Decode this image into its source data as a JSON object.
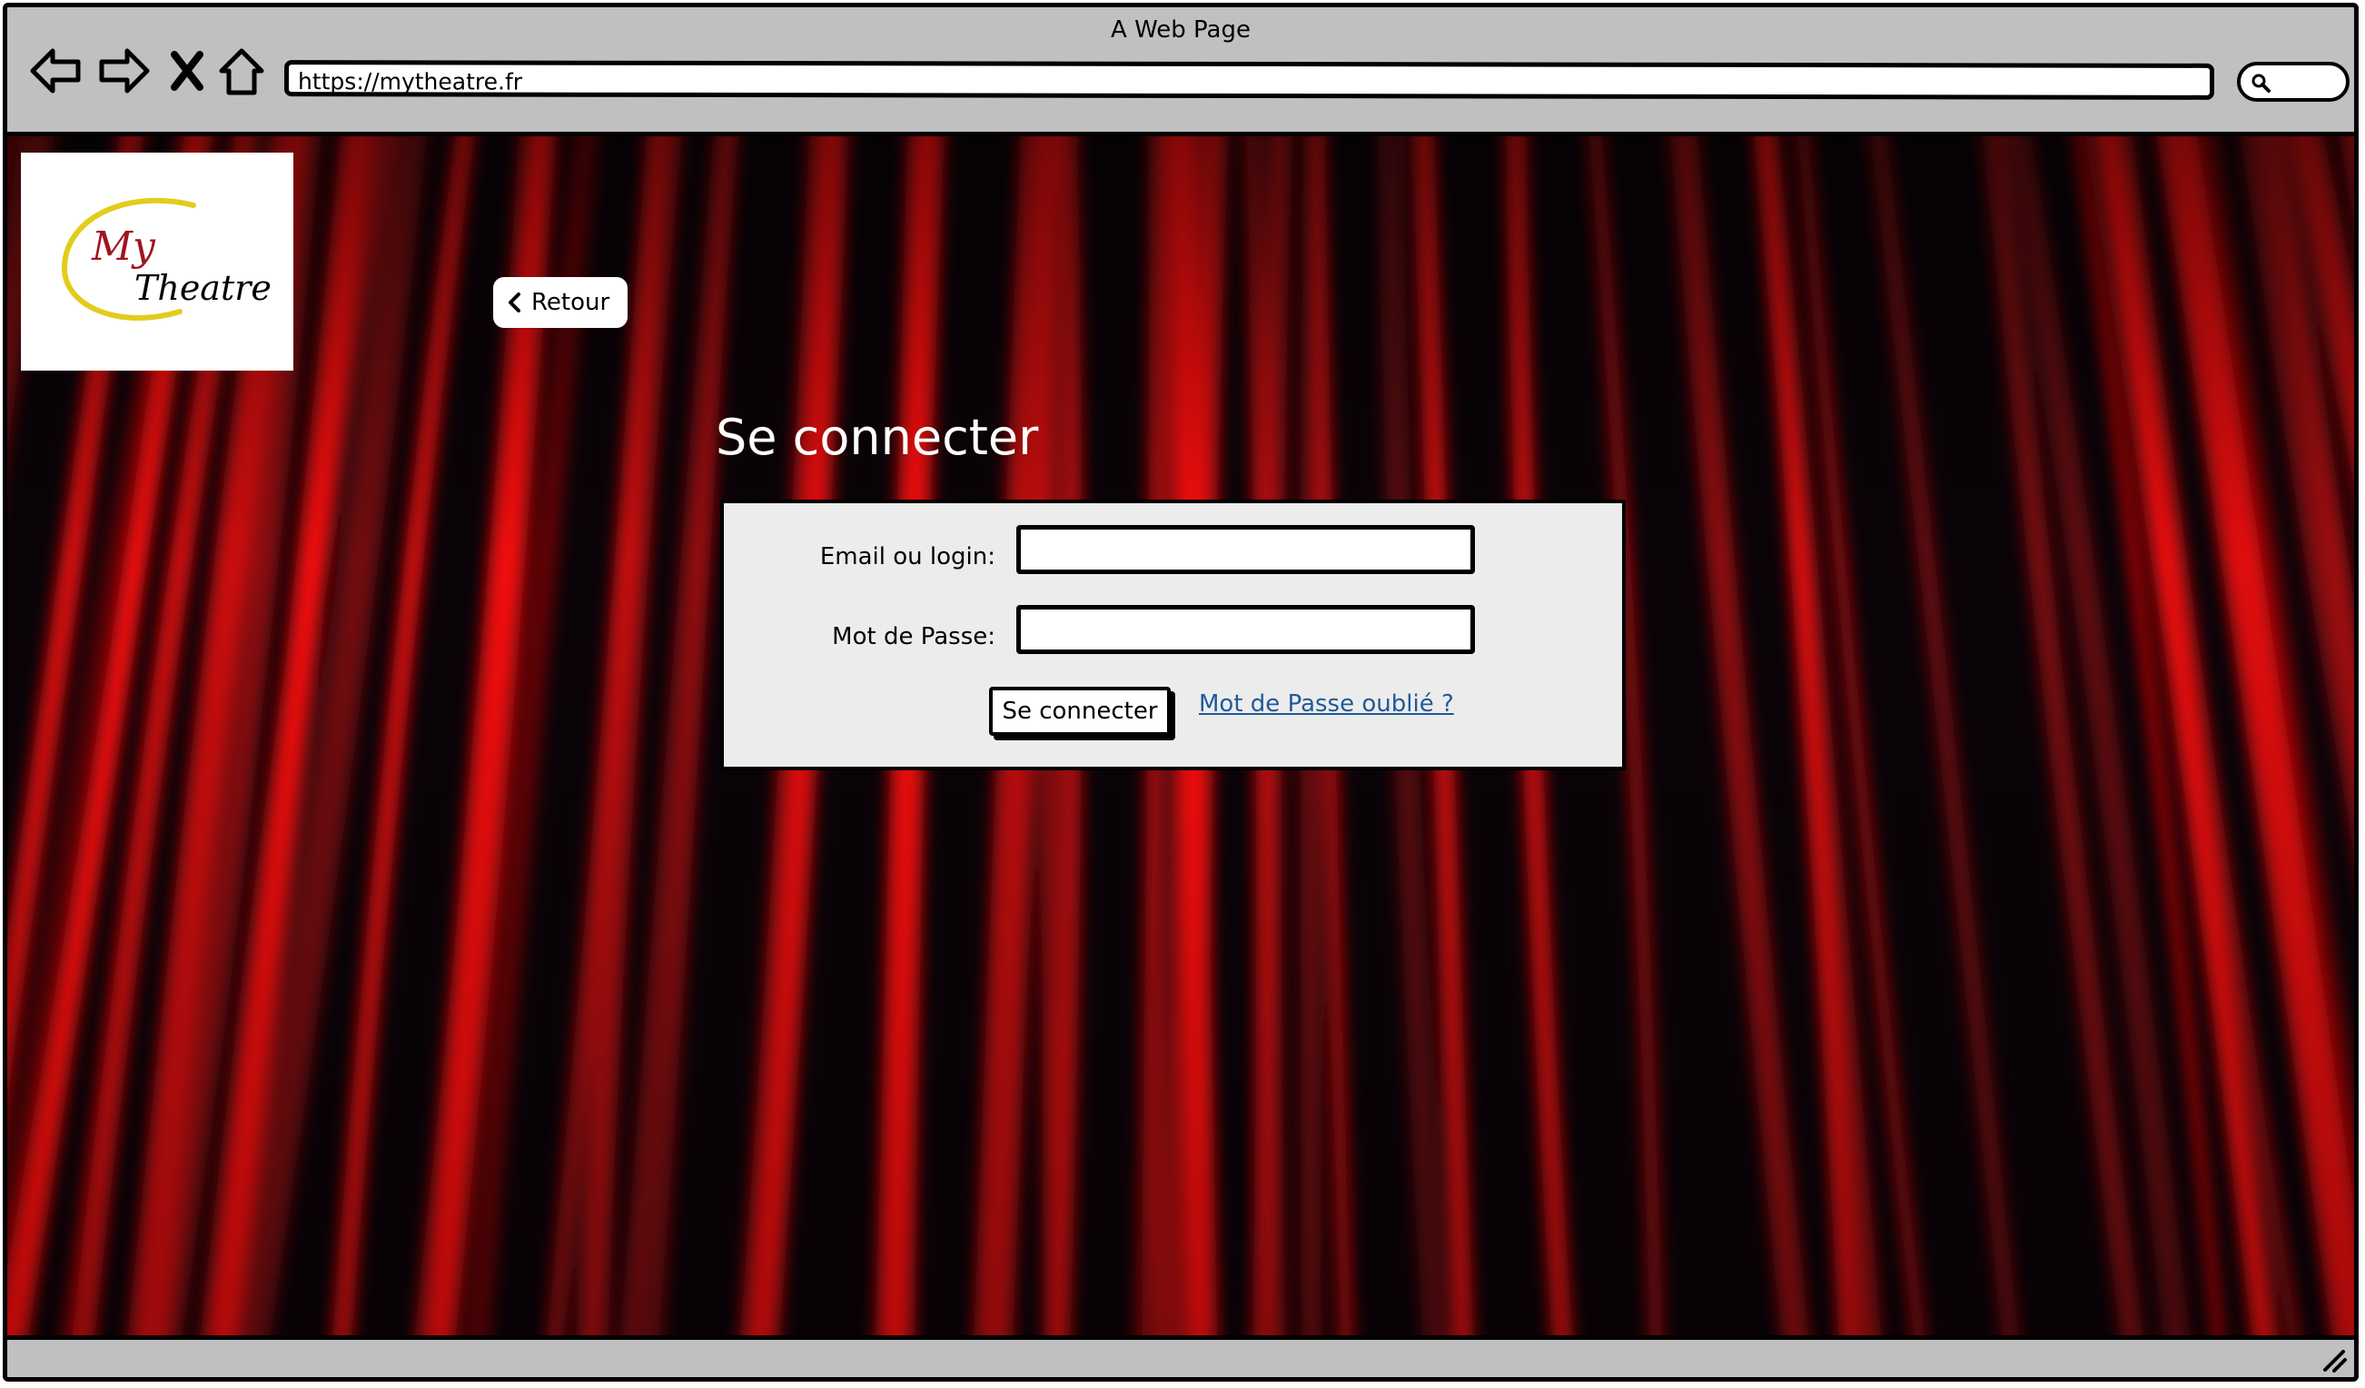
{
  "browser": {
    "window_title": "A Web Page",
    "url": "https://mytheatre.fr",
    "icons": [
      "back-arrow-icon",
      "forward-arrow-icon",
      "stop-icon",
      "home-icon",
      "search-icon"
    ]
  },
  "logo": {
    "line1": "My",
    "line2": "Theatre",
    "colors": {
      "my": "#a0141e",
      "theatre": "#000000",
      "swoosh": "#e2cc1c"
    }
  },
  "nav": {
    "back_label": "Retour",
    "back_icon": "chevron-left-icon"
  },
  "login": {
    "title": "Se connecter",
    "email_label": "Email ou login:",
    "email_value": "",
    "password_label": "Mot de Passe:",
    "password_value": "",
    "submit_label": "Se connecter",
    "forgot_label": "Mot de Passe oublié ?"
  },
  "theme": {
    "chrome": "#c0c0c0",
    "panel": "#ececec",
    "link": "#1f5a99",
    "curtain_red": "#ff1010",
    "curtain_dark": "#0a0308"
  }
}
